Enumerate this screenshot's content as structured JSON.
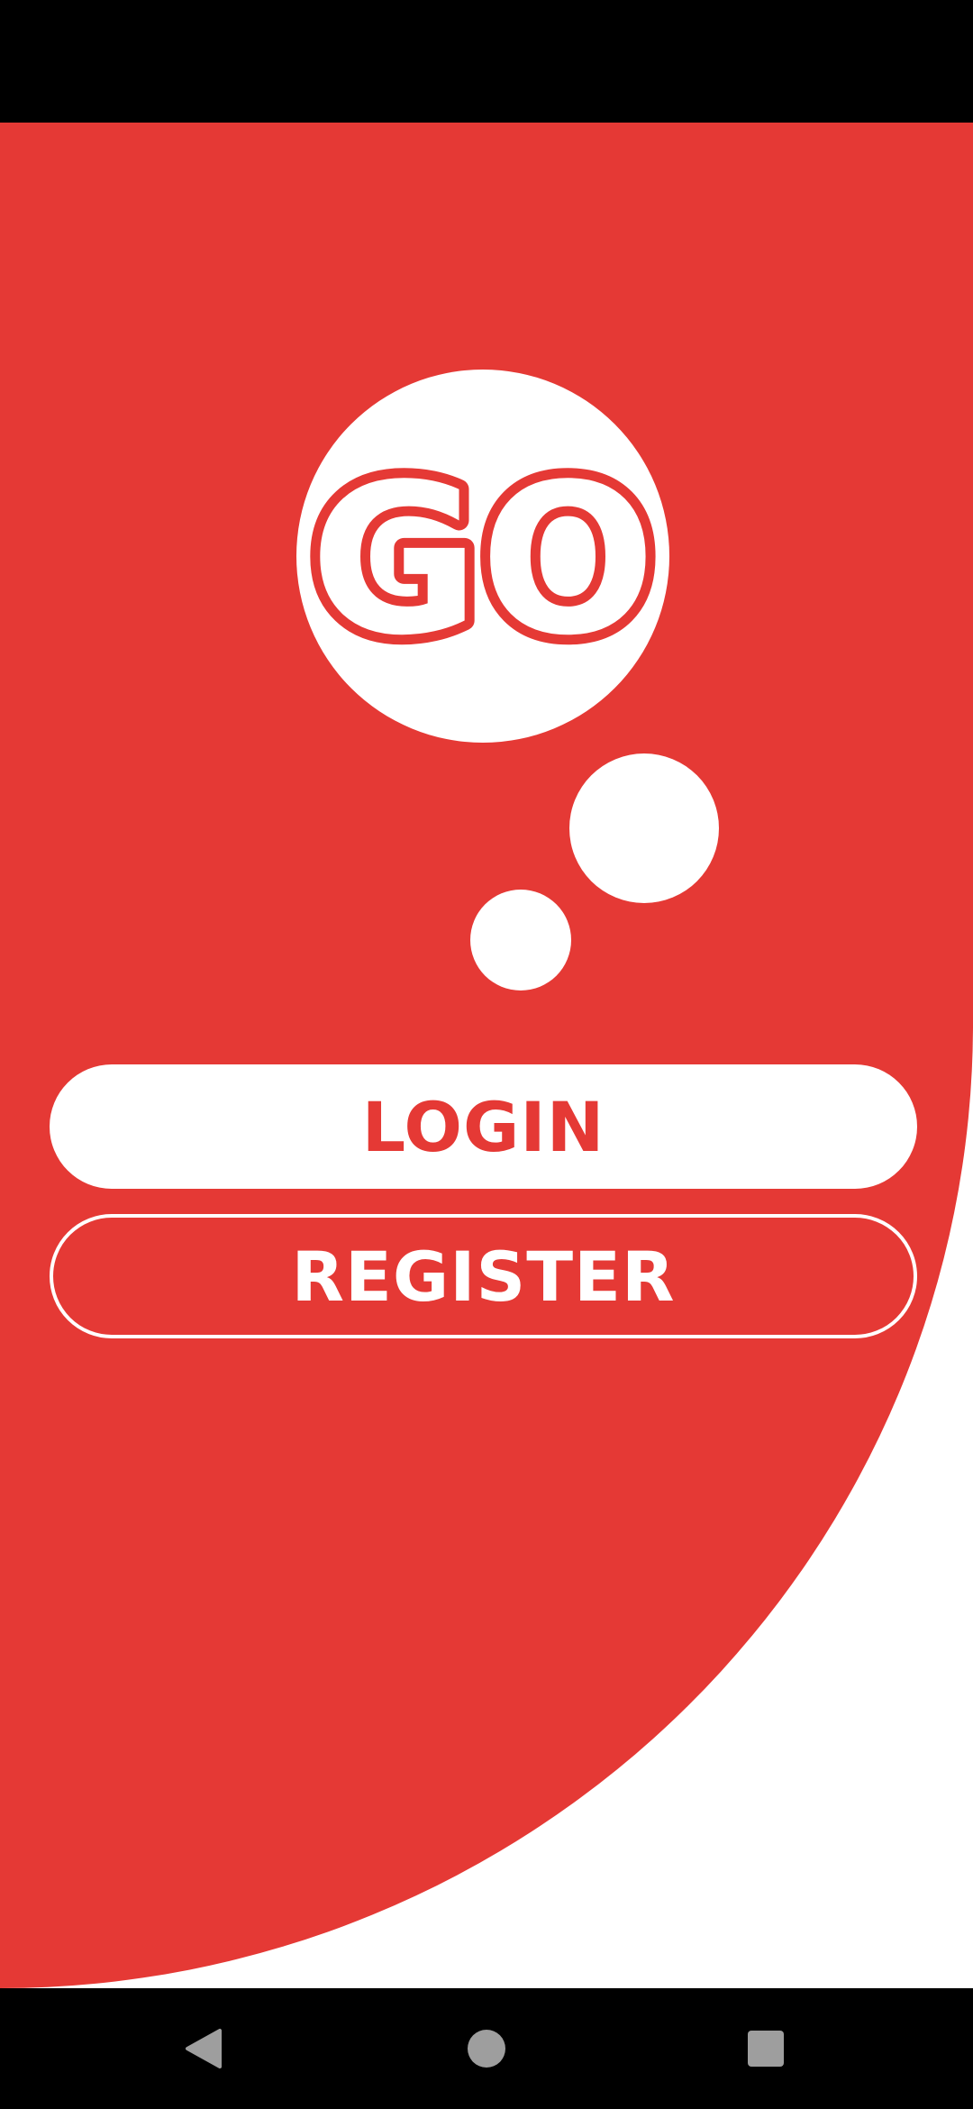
{
  "logo": {
    "text": "GO"
  },
  "buttons": {
    "login": "LOGIN",
    "register": "REGISTER"
  },
  "navigation": {
    "back_icon": "back-triangle-icon",
    "home_icon": "home-circle-icon",
    "recents_icon": "recents-square-icon"
  },
  "colors": {
    "brand_red": "#e53935",
    "white": "#ffffff",
    "system_bar": "#000000",
    "nav_icon": "#9e9e9e"
  }
}
